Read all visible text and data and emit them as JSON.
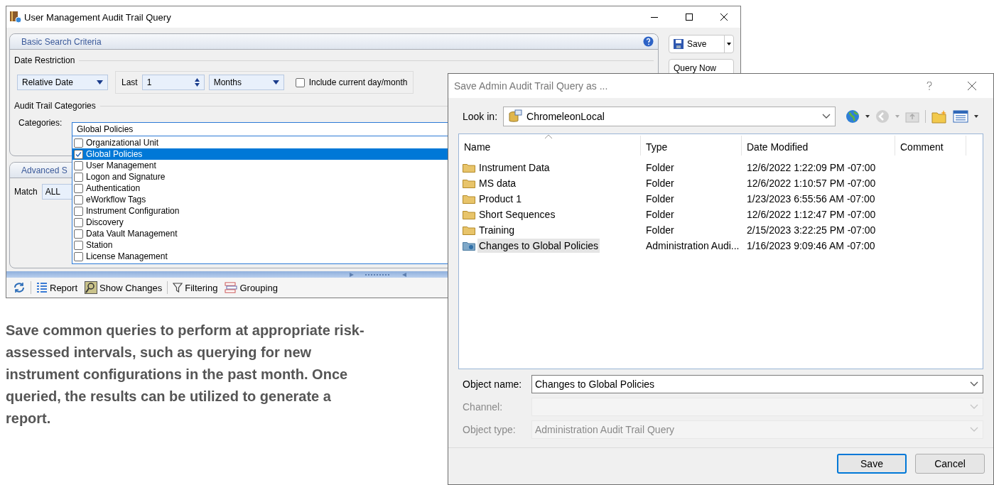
{
  "main_window": {
    "title": "User Management Audit Trail Query",
    "basic_panel": {
      "title": "Basic Search Criteria",
      "date_group": "Date Restriction",
      "date_mode": "Relative Date",
      "last_label": "Last",
      "last_value": "1",
      "unit": "Months",
      "include_current": {
        "label": "Include current day/month",
        "checked": false
      },
      "categories_group": "Audit Trail Categories",
      "categories_label": "Categories:",
      "categories_value": "Global Policies",
      "category_options": [
        {
          "label": "Organizational Unit",
          "checked": false,
          "selected": false
        },
        {
          "label": "Global Policies",
          "checked": true,
          "selected": true
        },
        {
          "label": "User Management",
          "checked": false,
          "selected": false
        },
        {
          "label": "Logon and Signature",
          "checked": false,
          "selected": false
        },
        {
          "label": "Authentication",
          "checked": false,
          "selected": false
        },
        {
          "label": "eWorkflow Tags",
          "checked": false,
          "selected": false
        },
        {
          "label": "Instrument Configuration",
          "checked": false,
          "selected": false
        },
        {
          "label": "Discovery",
          "checked": false,
          "selected": false
        },
        {
          "label": "Data Vault Management",
          "checked": false,
          "selected": false
        },
        {
          "label": "Station",
          "checked": false,
          "selected": false
        },
        {
          "label": "License Management",
          "checked": false,
          "selected": false
        }
      ]
    },
    "advanced_panel": {
      "title": "Advanced S",
      "match_label": "Match",
      "match_value": "ALL"
    },
    "side_buttons": [
      {
        "label": "Save",
        "kind": "split"
      },
      {
        "label": "Query Now",
        "kind": "plain"
      }
    ],
    "toolbar": [
      {
        "kind": "refresh"
      },
      {
        "kind": "report",
        "label": "Report"
      },
      {
        "kind": "changes",
        "label": "Show Changes"
      },
      {
        "kind": "filter",
        "label": "Filtering"
      },
      {
        "kind": "group",
        "label": "Grouping"
      }
    ]
  },
  "dialog": {
    "title": "Save Admin Audit Trail Query as ...",
    "look_in_label": "Look in:",
    "look_in_value": "ChromeleonLocal",
    "columns": [
      "Name",
      "Type",
      "Date Modified",
      "Comment"
    ],
    "rows": [
      {
        "kind": "folder",
        "name": "Instrument Data",
        "type": "Folder",
        "date": "12/6/2022 1:22:09 PM -07:00",
        "selected": false
      },
      {
        "kind": "folder",
        "name": "MS data",
        "type": "Folder",
        "date": "12/6/2022 1:10:57 PM -07:00",
        "selected": false
      },
      {
        "kind": "folder",
        "name": "Product 1",
        "type": "Folder",
        "date": "1/23/2023 6:55:56 AM -07:00",
        "selected": false
      },
      {
        "kind": "folder",
        "name": "Short Sequences",
        "type": "Folder",
        "date": "12/6/2022 1:12:47 PM -07:00",
        "selected": false
      },
      {
        "kind": "folder",
        "name": "Training",
        "type": "Folder",
        "date": "2/15/2023 3:22:25 PM -07:00",
        "selected": false
      },
      {
        "kind": "query",
        "name": "Changes to Global Policies",
        "type": "Administration Audi...",
        "date": "1/16/2023 9:09:46 AM -07:00",
        "selected": true
      }
    ],
    "fields": [
      {
        "label": "Object name:",
        "value": "Changes to Global Policies",
        "disabled": false
      },
      {
        "label": "Channel:",
        "disabled": true
      },
      {
        "label": "Object type:",
        "value": "Administration Audit Trail Query",
        "disabled": true
      }
    ],
    "buttons": [
      {
        "label": "Save",
        "default": true
      },
      {
        "label": "Cancel",
        "default": false
      }
    ]
  },
  "caption": "Save common queries to perform at appropriate risk-assessed intervals, such as querying for new instrument configurations in the past month. Once queried, the results can be utilized to generate a report."
}
